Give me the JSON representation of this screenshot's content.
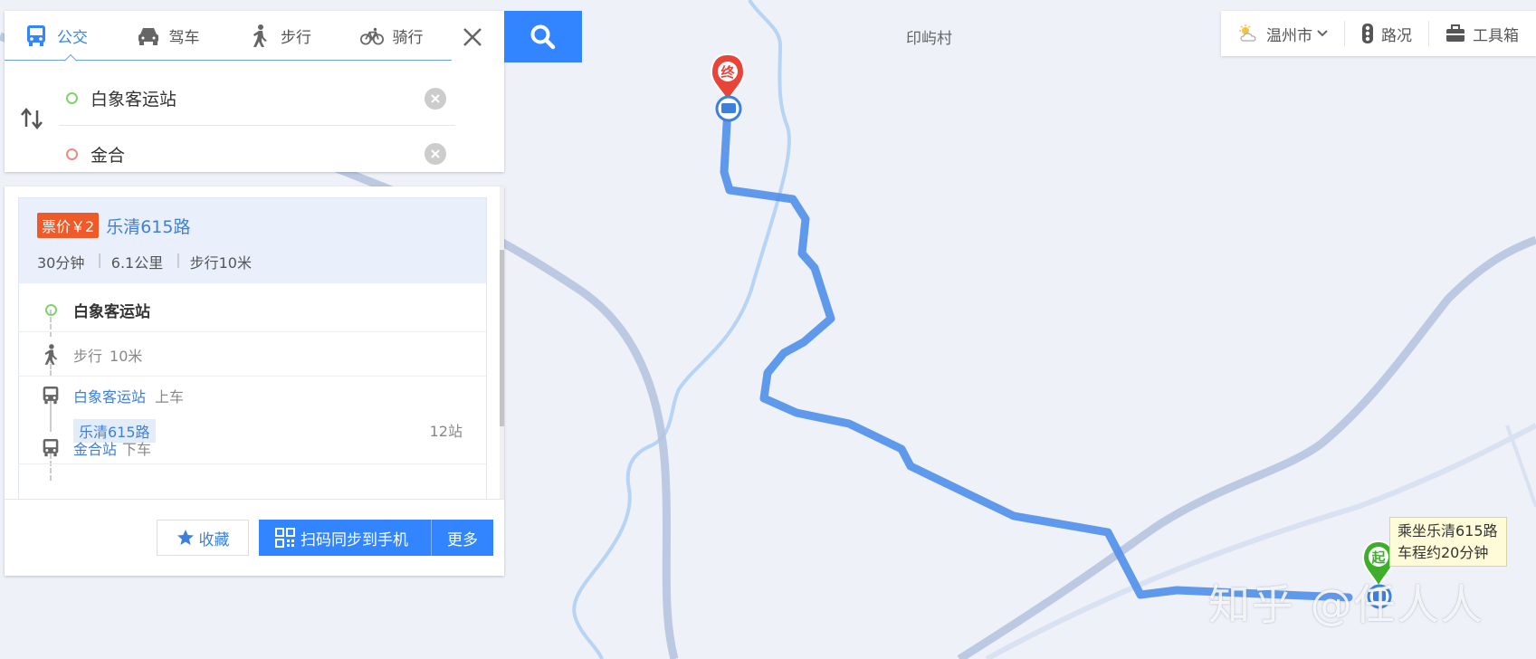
{
  "search": {
    "tabs": [
      {
        "label": "公交",
        "icon": "bus-icon",
        "active": true
      },
      {
        "label": "驾车",
        "icon": "car-icon"
      },
      {
        "label": "步行",
        "icon": "walk-icon"
      },
      {
        "label": "骑行",
        "icon": "bike-icon"
      }
    ],
    "from": "白象客运站",
    "to": "金合",
    "colors": {
      "accent": "#3385ff",
      "from_dot": "#7ed36b",
      "to_dot": "#f08a80"
    }
  },
  "result": {
    "fare": "票价￥2",
    "line": "乐清615路",
    "duration": "30分钟",
    "distance": "6.1公里",
    "walk": "步行10米",
    "steps": {
      "start": "白象客运站",
      "walk_label": "步行",
      "walk_dist": "10米",
      "board_station": "白象客运站",
      "board_action": "上车",
      "line_tag": "乐清615路",
      "stops": "12站",
      "alight_station": "金合站",
      "alight_action": "下车"
    },
    "fav_label": "收藏",
    "sync_label": "扫码同步到手机",
    "more_label": "更多"
  },
  "toolbar": {
    "city": "温州市",
    "traffic": "路况",
    "tools": "工具箱"
  },
  "map": {
    "village_label": "印屿村",
    "end_marker": "终",
    "start_marker": "起",
    "tooltip_line1": "乘坐乐清615路",
    "tooltip_line2": "车程约20分钟",
    "route_color": "#4f8fea"
  },
  "watermark": "知乎 @任人人"
}
